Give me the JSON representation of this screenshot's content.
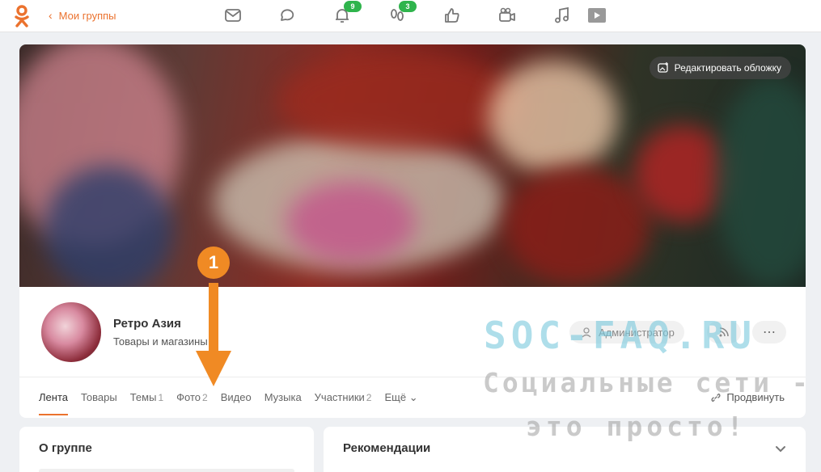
{
  "header": {
    "back_label": "Мои группы",
    "notifications_badge": "9",
    "guests_badge": "3"
  },
  "icons": {
    "logo": "odnoklassniki-logo",
    "back": "chevron-left-icon",
    "nav": [
      "envelope-icon",
      "chat-bubble-icon",
      "bell-icon",
      "footprints-icon",
      "thumbs-up-icon",
      "video-camera-icon",
      "music-note-icon",
      "play-icon"
    ]
  },
  "cover": {
    "edit_label": "Редактировать обложку"
  },
  "group": {
    "name": "Ретро Азия",
    "category": "Товары и магазины",
    "admin_label": "Администратор"
  },
  "tabs": [
    {
      "label": "Лента",
      "count": ""
    },
    {
      "label": "Товары",
      "count": ""
    },
    {
      "label": "Темы",
      "count": "1"
    },
    {
      "label": "Фото",
      "count": "2"
    },
    {
      "label": "Видео",
      "count": ""
    },
    {
      "label": "Музыка",
      "count": ""
    },
    {
      "label": "Участники",
      "count": "2"
    },
    {
      "label": "Ещё",
      "count": ""
    }
  ],
  "promote_label": "Продвинуть",
  "about": {
    "title": "О группе"
  },
  "recommendations": {
    "title": "Рекомендации"
  },
  "watermark": {
    "line1": "SOC-FAQ.RU",
    "line2": "Социальные сети -",
    "line3": "это просто!"
  },
  "annotation": {
    "number": "1"
  },
  "colors": {
    "accent": "#eb722e",
    "badge": "#2fb44c",
    "annotation": "#f08a24"
  }
}
